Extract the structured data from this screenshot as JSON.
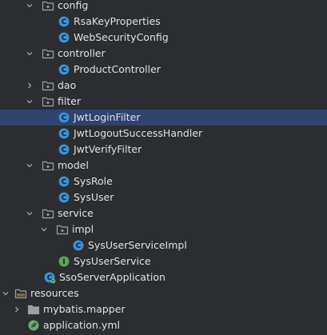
{
  "colors": {
    "background": "#2b2d30",
    "selection": "#2e436e",
    "text": "#dfe1e5",
    "folder": "#9da0a8",
    "class_icon": "#3b8fd6",
    "interface_icon": "#5aa454",
    "yml_icon": "#6aab73"
  },
  "tree": [
    {
      "label": "config",
      "icon": "folder-icon",
      "expanded": true,
      "level": 2
    },
    {
      "label": "RsaKeyProperties",
      "icon": "class-icon",
      "level": 3
    },
    {
      "label": "WebSecurityConfig",
      "icon": "class-icon",
      "level": 3
    },
    {
      "label": "controller",
      "icon": "folder-icon",
      "expanded": true,
      "level": 2
    },
    {
      "label": "ProductController",
      "icon": "class-icon",
      "level": 3
    },
    {
      "label": "dao",
      "icon": "folder-icon",
      "expanded": false,
      "level": 2
    },
    {
      "label": "filter",
      "icon": "folder-icon",
      "expanded": true,
      "level": 2
    },
    {
      "label": "JwtLoginFilter",
      "icon": "class-icon",
      "level": 3,
      "selected": true
    },
    {
      "label": "JwtLogoutSuccessHandler",
      "icon": "class-icon",
      "level": 3
    },
    {
      "label": "JwtVerifyFilter",
      "icon": "class-icon",
      "level": 3
    },
    {
      "label": "model",
      "icon": "folder-icon",
      "expanded": true,
      "level": 2
    },
    {
      "label": "SysRole",
      "icon": "class-icon",
      "level": 3
    },
    {
      "label": "SysUser",
      "icon": "class-icon",
      "level": 3
    },
    {
      "label": "service",
      "icon": "folder-icon",
      "expanded": true,
      "level": 2
    },
    {
      "label": "impl",
      "icon": "folder-icon",
      "expanded": true,
      "level": 3
    },
    {
      "label": "SysUserServiceImpl",
      "icon": "class-icon",
      "level": 4
    },
    {
      "label": "SysUserService",
      "icon": "interface-icon",
      "level": 3
    },
    {
      "label": "SsoServerApplication",
      "icon": "spring-class-icon",
      "level": 2
    },
    {
      "label": "resources",
      "icon": "resources-folder-icon",
      "expanded": true,
      "level": 0
    },
    {
      "label": "mybatis.mapper",
      "icon": "folder-icon",
      "expanded": false,
      "level": 1
    },
    {
      "label": "application.yml",
      "icon": "yml-file-icon",
      "level": 1
    }
  ]
}
